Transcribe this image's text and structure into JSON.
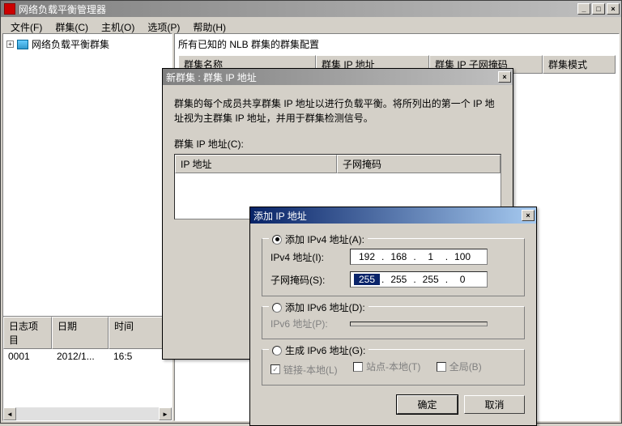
{
  "mainWindow": {
    "title": "网络负载平衡管理器",
    "menu": {
      "file": "文件(F)",
      "cluster": "群集(C)",
      "host": "主机(O)",
      "options": "选项(P)",
      "help": "帮助(H)"
    },
    "tree": {
      "root": "网络负载平衡群集",
      "expander": "+"
    },
    "listHeader": "所有已知的 NLB 群集的群集配置",
    "cols": {
      "name": "群集名称",
      "ip": "群集 IP 地址",
      "mask": "群集 IP 子网掩码",
      "mode": "群集模式"
    },
    "log": {
      "cols": {
        "item": "日志项目",
        "date": "日期",
        "time": "时间"
      },
      "row": {
        "item": "0001",
        "date": "2012/1...",
        "time": "16:5"
      }
    }
  },
  "newClusterDialog": {
    "title": "新群集 : 群集 IP 地址",
    "desc": "群集的每个成员共享群集 IP 地址以进行负载平衡。将所列出的第一个 IP 地址视为主群集 IP 地址，并用于群集检测信号。",
    "sectionLabel": "群集 IP 地址(C):",
    "tcols": {
      "ip": "IP 地址",
      "mask": "子网掩码"
    }
  },
  "addIpDialog": {
    "title": "添加 IP 地址",
    "group1": {
      "legend": "添加 IPv4 地址(A):",
      "ipv4Label": "IPv4 地址(I):",
      "ipv4": {
        "a": "192",
        "b": "168",
        "c": "1",
        "d": "100"
      },
      "maskLabel": "子网掩码(S):",
      "mask": {
        "a": "255",
        "b": "255",
        "c": "255",
        "d": "0"
      }
    },
    "group2": {
      "legend": "添加 IPv6 地址(D):",
      "ipv6Label": "IPv6 地址(P):"
    },
    "group3": {
      "legend": "生成 IPv6 地址(G):",
      "opts": {
        "link": "链接-本地(L)",
        "site": "站点-本地(T)",
        "global": "全局(B)"
      }
    },
    "buttons": {
      "ok": "确定",
      "cancel": "取消"
    }
  }
}
